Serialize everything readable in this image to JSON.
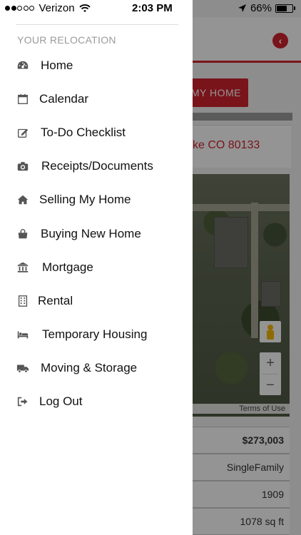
{
  "status_bar": {
    "carrier": "Verizon",
    "time": "2:03 PM",
    "battery_percent": "66%",
    "battery_level": 0.66
  },
  "menu": {
    "section_title": "YOUR RELOCATION",
    "items": [
      {
        "label": "Home",
        "icon": "dashboard-icon"
      },
      {
        "label": "Calendar",
        "icon": "calendar-icon"
      },
      {
        "label": "To-Do Checklist",
        "icon": "edit-icon"
      },
      {
        "label": "Receipts/Documents",
        "icon": "camera-icon"
      },
      {
        "label": "Selling My Home",
        "icon": "house-icon"
      },
      {
        "label": "Buying New Home",
        "icon": "shopping-bag-icon"
      },
      {
        "label": "Mortgage",
        "icon": "bank-icon"
      },
      {
        "label": "Rental",
        "icon": "building-icon"
      },
      {
        "label": "Temporary Housing",
        "icon": "bed-icon"
      },
      {
        "label": "Moving & Storage",
        "icon": "truck-icon"
      },
      {
        "label": "Log Out",
        "icon": "sign-out-icon"
      }
    ]
  },
  "background_app": {
    "cta_button": "MY HOME",
    "address": "ke CO 80133",
    "map_terms": "Terms of Use",
    "details": [
      "$273,003",
      "SingleFamily",
      "1909",
      "1078 sq ft"
    ],
    "accent_color": "#d1242f"
  }
}
